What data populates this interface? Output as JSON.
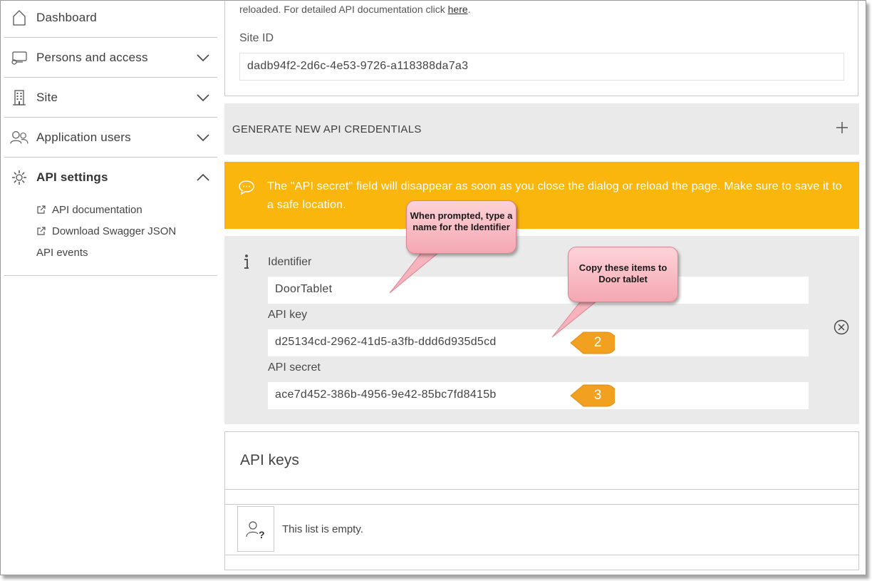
{
  "sidebar": {
    "items": [
      {
        "label": "Dashboard",
        "icon": "home-icon"
      },
      {
        "label": "Persons and access",
        "icon": "id-card-icon"
      },
      {
        "label": "Site",
        "icon": "building-icon"
      },
      {
        "label": "Application users",
        "icon": "users-icon"
      },
      {
        "label": "API settings",
        "icon": "gear-icon"
      }
    ],
    "sub_items": [
      {
        "label": "API documentation",
        "icon": "external-link-icon"
      },
      {
        "label": "Download Swagger JSON",
        "icon": "external-link-icon"
      },
      {
        "label": "API events"
      }
    ]
  },
  "site": {
    "reload_text": "reloaded. For detailed API documentation click ",
    "here_link": "here",
    "reload_suffix": ".",
    "site_id_label": "Site ID",
    "site_id_value": "dadb94f2-2d6c-4e53-9726-a118388da7a3"
  },
  "generate": {
    "label": "GENERATE NEW API CREDENTIALS"
  },
  "warning": {
    "text": "The \"API secret\" field will disappear as soon as you close the dialog or reload the page. Make sure to save it to a safe location."
  },
  "credentials": {
    "identifier_label": "Identifier",
    "identifier_value": "DoorTablet",
    "api_key_label": "API key",
    "api_key_value": "d25134cd-2962-41d5-a3fb-ddd6d935d5cd",
    "api_secret_label": "API secret",
    "api_secret_value": "ace7d452-386b-4956-9e42-85bc7fd8415b"
  },
  "api_keys": {
    "title": "API keys",
    "empty_text": "This list is empty."
  },
  "callouts": {
    "prompted": "When prompted, type a name for the Identifier",
    "copy": "Copy these items to Door tablet",
    "badge_2": "2",
    "badge_3": "3"
  },
  "colors": {
    "warning_bg": "#fbb60e",
    "panel_bg": "#eaeaea",
    "callout_pink": "#f4a7b2",
    "badge_orange": "#f2a020"
  }
}
